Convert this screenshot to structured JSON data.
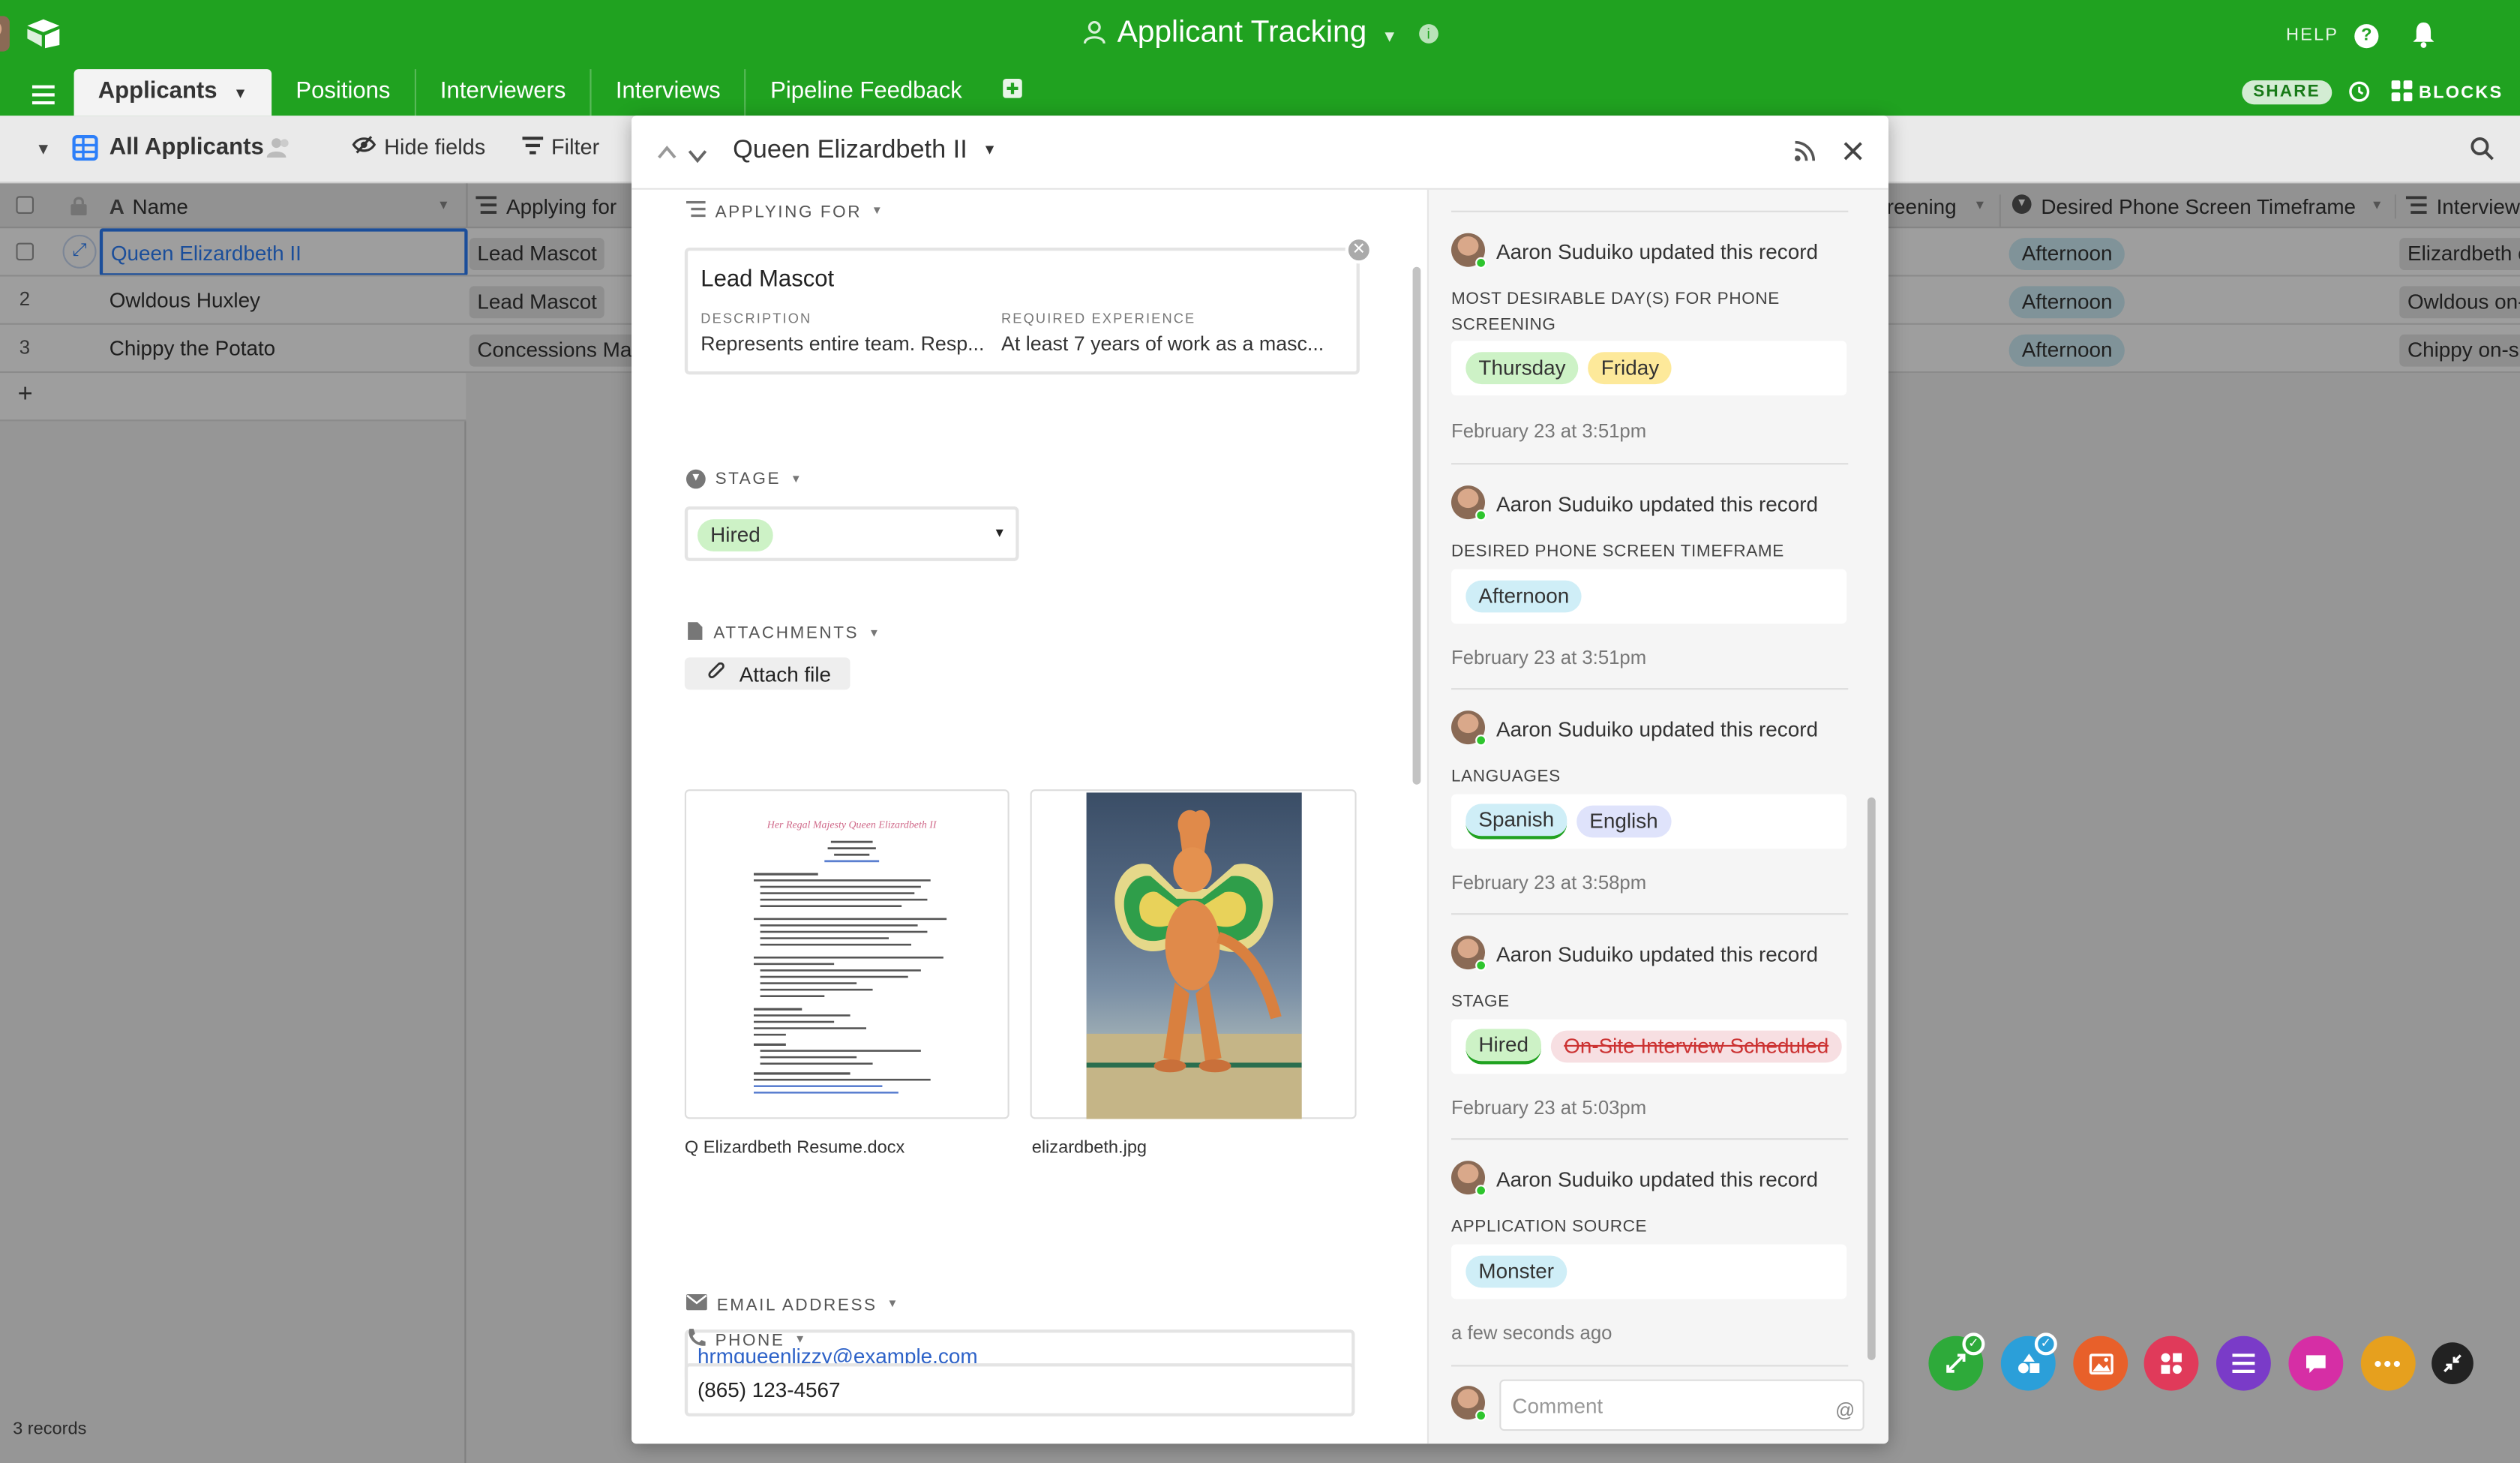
{
  "app": {
    "title": "Applicant Tracking",
    "help": "HELP",
    "share": "SHARE",
    "blocks": "BLOCKS"
  },
  "tabs": [
    {
      "label": "Applicants"
    },
    {
      "label": "Positions"
    },
    {
      "label": "Interviewers"
    },
    {
      "label": "Interviews"
    },
    {
      "label": "Pipeline Feedback"
    }
  ],
  "toolbar": {
    "view_name": "All Applicants",
    "hide_fields": "Hide fields",
    "filter": "Filter"
  },
  "grid": {
    "headers": {
      "name": "Name",
      "applying_for": "Applying for",
      "screening": "reening",
      "timeframe": "Desired Phone Screen Timeframe",
      "interviews": "Interviews"
    },
    "rows": [
      {
        "num": "",
        "name": "Queen Elizardbeth II",
        "applying": "Lead Mascot",
        "timeframe": "Afternoon",
        "interview": "Elizardbeth o"
      },
      {
        "num": "2",
        "name": "Owldous Huxley",
        "applying": "Lead Mascot",
        "timeframe": "Afternoon",
        "interview": "Owldous on-"
      },
      {
        "num": "3",
        "name": "Chippy the Potato",
        "applying": "Concessions Mas",
        "timeframe": "Afternoon",
        "interview": "Chippy on-si"
      }
    ],
    "add_row": "+",
    "record_count": "3 records"
  },
  "record": {
    "title": "Queen Elizardbeth II",
    "applying_for": {
      "label": "APPLYING FOR",
      "card_title": "Lead Mascot",
      "desc_label": "DESCRIPTION",
      "desc_value": "Represents entire team. Resp...",
      "exp_label": "REQUIRED EXPERIENCE",
      "exp_value": "At least 7 years of work as a masc..."
    },
    "stage": {
      "label": "STAGE",
      "value": "Hired"
    },
    "attachments": {
      "label": "ATTACHMENTS",
      "attach_button": "Attach file",
      "files": [
        {
          "name": "Q Elizardbeth Resume.docx",
          "doc_heading": "Her Regal Majesty Queen Elizardbeth II"
        },
        {
          "name": "elizardbeth.jpg"
        }
      ]
    },
    "email": {
      "label": "EMAIL ADDRESS",
      "value": "hrmqueenlizzy@example.com"
    },
    "phone": {
      "label": "PHONE",
      "value": "(865) 123-4567"
    }
  },
  "activity": [
    {
      "user": "Aaron Suduiko updated this record",
      "field_line1": "MOST DESIRABLE DAY(S) FOR PHONE",
      "field_line2": "SCREENING",
      "values": [
        "Thursday",
        "Friday"
      ],
      "date": "February 23 at 3:51pm"
    },
    {
      "user": "Aaron Suduiko updated this record",
      "field_line1": "DESIRED PHONE SCREEN TIMEFRAME",
      "values": [
        "Afternoon"
      ],
      "date": "February 23 at 3:51pm"
    },
    {
      "user": "Aaron Suduiko updated this record",
      "field_line1": "LANGUAGES",
      "values": [
        "Spanish",
        "English"
      ],
      "date": "February 23 at 3:58pm"
    },
    {
      "user": "Aaron Suduiko updated this record",
      "field_line1": "STAGE",
      "values": [
        "Hired",
        "On-Site Interview Scheduled"
      ],
      "date": "February 23 at 5:03pm"
    },
    {
      "user": "Aaron Suduiko updated this record",
      "field_line1": "APPLICATION SOURCE",
      "values": [
        "Monster"
      ],
      "date": "a few seconds ago"
    }
  ],
  "comment": {
    "placeholder": "Comment",
    "at_symbol": "@"
  },
  "colors": {
    "brand_green": "#20a220",
    "selected_blue": "#2d7ff9"
  }
}
